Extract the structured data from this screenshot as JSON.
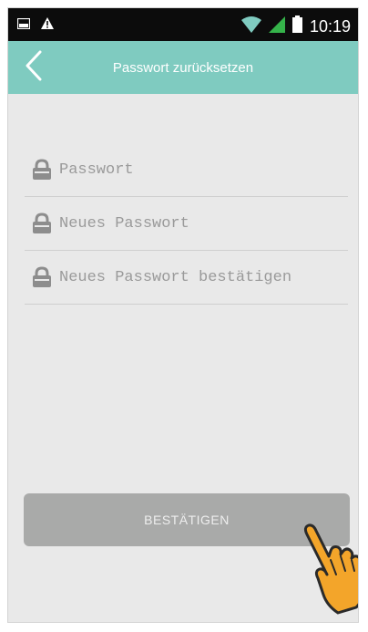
{
  "status_bar": {
    "time": "10:19",
    "icons": [
      "screenshot-icon",
      "warning-icon",
      "wifi-icon",
      "signal-icon",
      "battery-icon"
    ]
  },
  "header": {
    "title": "Passwort zurücksetzen",
    "back_icon": "chevron-left-icon",
    "background": "#7fcbc0"
  },
  "form": {
    "fields": [
      {
        "placeholder": "Passwort",
        "value": "",
        "icon": "lock-icon"
      },
      {
        "placeholder": "Neues Passwort",
        "value": "",
        "icon": "lock-icon"
      },
      {
        "placeholder": "Neues Passwort bestätigen",
        "value": "",
        "icon": "lock-icon"
      }
    ],
    "confirm_label": "BESTÄTIGEN"
  },
  "overlay": {
    "pointer_icon": "tapping-hand-icon",
    "pointer_color": "#f3a52a"
  },
  "colors": {
    "screen_bg": "#e9e9e9",
    "button_bg": "#a9aaa9",
    "divider": "#cfcfcf"
  }
}
